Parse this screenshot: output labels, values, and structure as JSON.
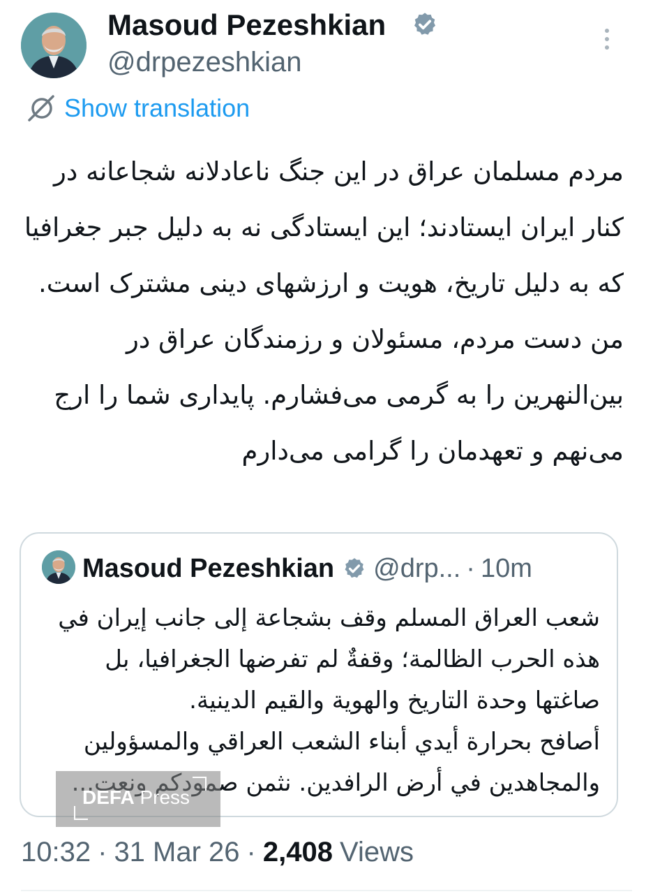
{
  "author": {
    "display_name": "Masoud Pezeshkian",
    "handle": "@drpezeshkian",
    "verified": true
  },
  "translation": {
    "label": "Show translation",
    "icon": "globe-slash-icon"
  },
  "tweet": {
    "paragraphs": [
      "مردم مسلمان عراق در این جنگ ناعادلانه شجاعانه در کنار ایران ایستادند؛ این ایستادگی نه به دلیل جبر جغرافیا که به دلیل تاریخ، هویت و ارزشهای دینی مشترک است.",
      "من دست مردم، مسئولان و رزمندگان عراق در بین‌النهرین را به گرمی می‌فشارم. پایداری شما را ارج می‌نهم و تعهدمان را گرامی می‌دارم"
    ]
  },
  "quoted": {
    "display_name": "Masoud Pezeshkian",
    "handle": "@drp...",
    "separator": "·",
    "time": "10m",
    "paragraphs": [
      "شعب العراق المسلم وقف بشجاعة إلى جانب إيران في هذه الحرب الظالمة؛ وقفةٌ لم تفرضها الجغرافيا، بل صاغتها وحدة التاريخ والهوية والقيم الدينية.",
      "أصافح بحرارة أيدي أبناء الشعب العراقي والمسؤولين والمجاهدين في أرض الرافدين. نثمن صمودكم ونعت..."
    ]
  },
  "watermark": {
    "strong": "DEFA",
    "light": " Press"
  },
  "meta": {
    "time": "10:32",
    "date": "31 Mar 26",
    "separator": "·",
    "views_count": "2,408",
    "views_label": "Views"
  },
  "colors": {
    "accent": "#1d9bf0",
    "muted": "#536471",
    "text": "#0f1419",
    "border": "#cfd9de",
    "verified_badge": "#829aab"
  }
}
